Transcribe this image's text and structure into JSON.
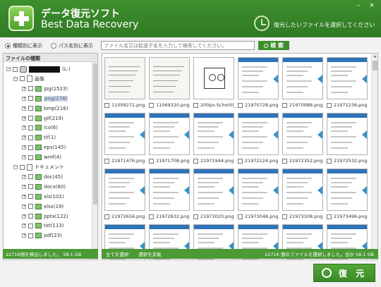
{
  "header": {
    "title_ja": "データ復元ソフト",
    "title_en": "Best Data Recovery",
    "instruction": "復元したいファイルを選択してください",
    "min_glyph": "–",
    "close_glyph": "×"
  },
  "options": {
    "by_type": "種類別に表示",
    "by_path": "パス名別に表示",
    "selected": "by_type"
  },
  "search": {
    "placeholder": "ファイル名又は拡張子名を入力して検索してください。",
    "button": "検 索"
  },
  "tree": {
    "header": "ファイルの種類",
    "drive_suffix": "(L:)",
    "image_group": "画像",
    "image_items": [
      "jpg(1523)",
      "png(278)",
      "bmp(216)",
      "gif(219)",
      "ico(6)",
      "tif(1)",
      "eps(145)",
      "wmf(4)"
    ],
    "selected_item": "png(278)",
    "doc_group": "ドキュメント",
    "doc_items": [
      "doc(45)",
      "docx(60)",
      "xls(102)",
      "xlsx(19)",
      "pptx(122)",
      "txt(113)",
      "pdf(23)"
    ]
  },
  "files": [
    "11009272.png",
    "11069320.png",
    "200px-Schmitt_",
    "21970728.png",
    "21970988.png",
    "21971236.png",
    "21971476.png",
    "21971708.png",
    "21971944.png",
    "21972124.png",
    "21972352.png",
    "21972532.png",
    "21972656.png",
    "21972832.png",
    "21973020.png",
    "21973048.png",
    "21973308.png",
    "21973496.png",
    "",
    "",
    "",
    "",
    "",
    ""
  ],
  "status": {
    "left": "22716個を検出しました。 58.1 GB",
    "select_all": "全てを選択",
    "invert": "選択を反転",
    "right": "22716 個のファイルを選択しました。合計 58.1 GB"
  },
  "recover_button": "復 元",
  "colors": {
    "brand_green": "#3d8f2c",
    "status_green": "#4b9a36",
    "selected_text": "#2a5cb8"
  }
}
